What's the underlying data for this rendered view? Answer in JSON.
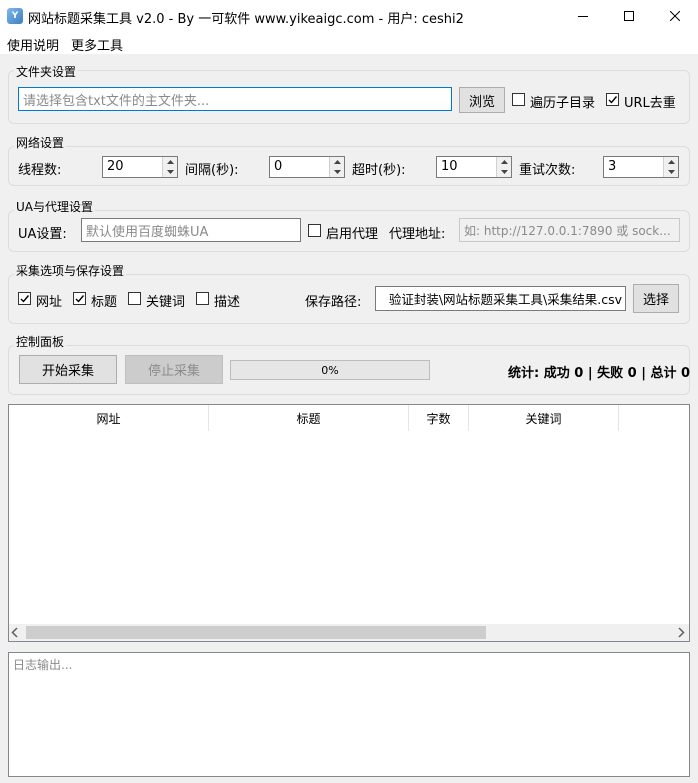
{
  "window": {
    "title": "网站标题采集工具 v2.0 - By 一可软件 www.yikeaigc.com - 用户: ceshi2",
    "icon": "app-logo-icon"
  },
  "menu": {
    "items": [
      "使用说明",
      "更多工具"
    ]
  },
  "folder": {
    "group_label": "文件夹设置",
    "path_placeholder": "请选择包含txt文件的主文件夹...",
    "browse_label": "浏览",
    "recursive_label": "遍历子目录",
    "recursive_checked": false,
    "dedupe_label": "URL去重",
    "dedupe_checked": true
  },
  "network": {
    "group_label": "网络设置",
    "threads_label": "线程数:",
    "threads_value": "20",
    "interval_label": "间隔(秒):",
    "interval_value": "0",
    "timeout_label": "超时(秒):",
    "timeout_value": "10",
    "retries_label": "重试次数:",
    "retries_value": "3"
  },
  "proxy": {
    "group_label": "UA与代理设置",
    "ua_label": "UA设置:",
    "ua_placeholder": "默认使用百度蜘蛛UA",
    "enable_proxy_label": "启用代理",
    "enable_proxy_checked": false,
    "proxy_addr_label": "代理地址:",
    "proxy_addr_placeholder": "如: http://127.0.0.1:7890 或 sock..."
  },
  "collect": {
    "group_label": "采集选项与保存设置",
    "options": [
      {
        "label": "网址",
        "checked": true
      },
      {
        "label": "标题",
        "checked": true
      },
      {
        "label": "关键词",
        "checked": false
      },
      {
        "label": "描述",
        "checked": false
      }
    ],
    "save_path_label": "保存路径:",
    "save_path_value": "验证封装\\网站标题采集工具\\采集结果.csv",
    "choose_label": "选择"
  },
  "control": {
    "group_label": "控制面板",
    "start_label": "开始采集",
    "stop_label": "停止采集",
    "progress_text": "0%",
    "progress": 0,
    "stats_text": "统计: 成功 0 | 失败 0 | 总计 0"
  },
  "table": {
    "columns": [
      "网址",
      "标题",
      "字数",
      "关键词"
    ],
    "rows": []
  },
  "log": {
    "placeholder": "日志输出..."
  }
}
